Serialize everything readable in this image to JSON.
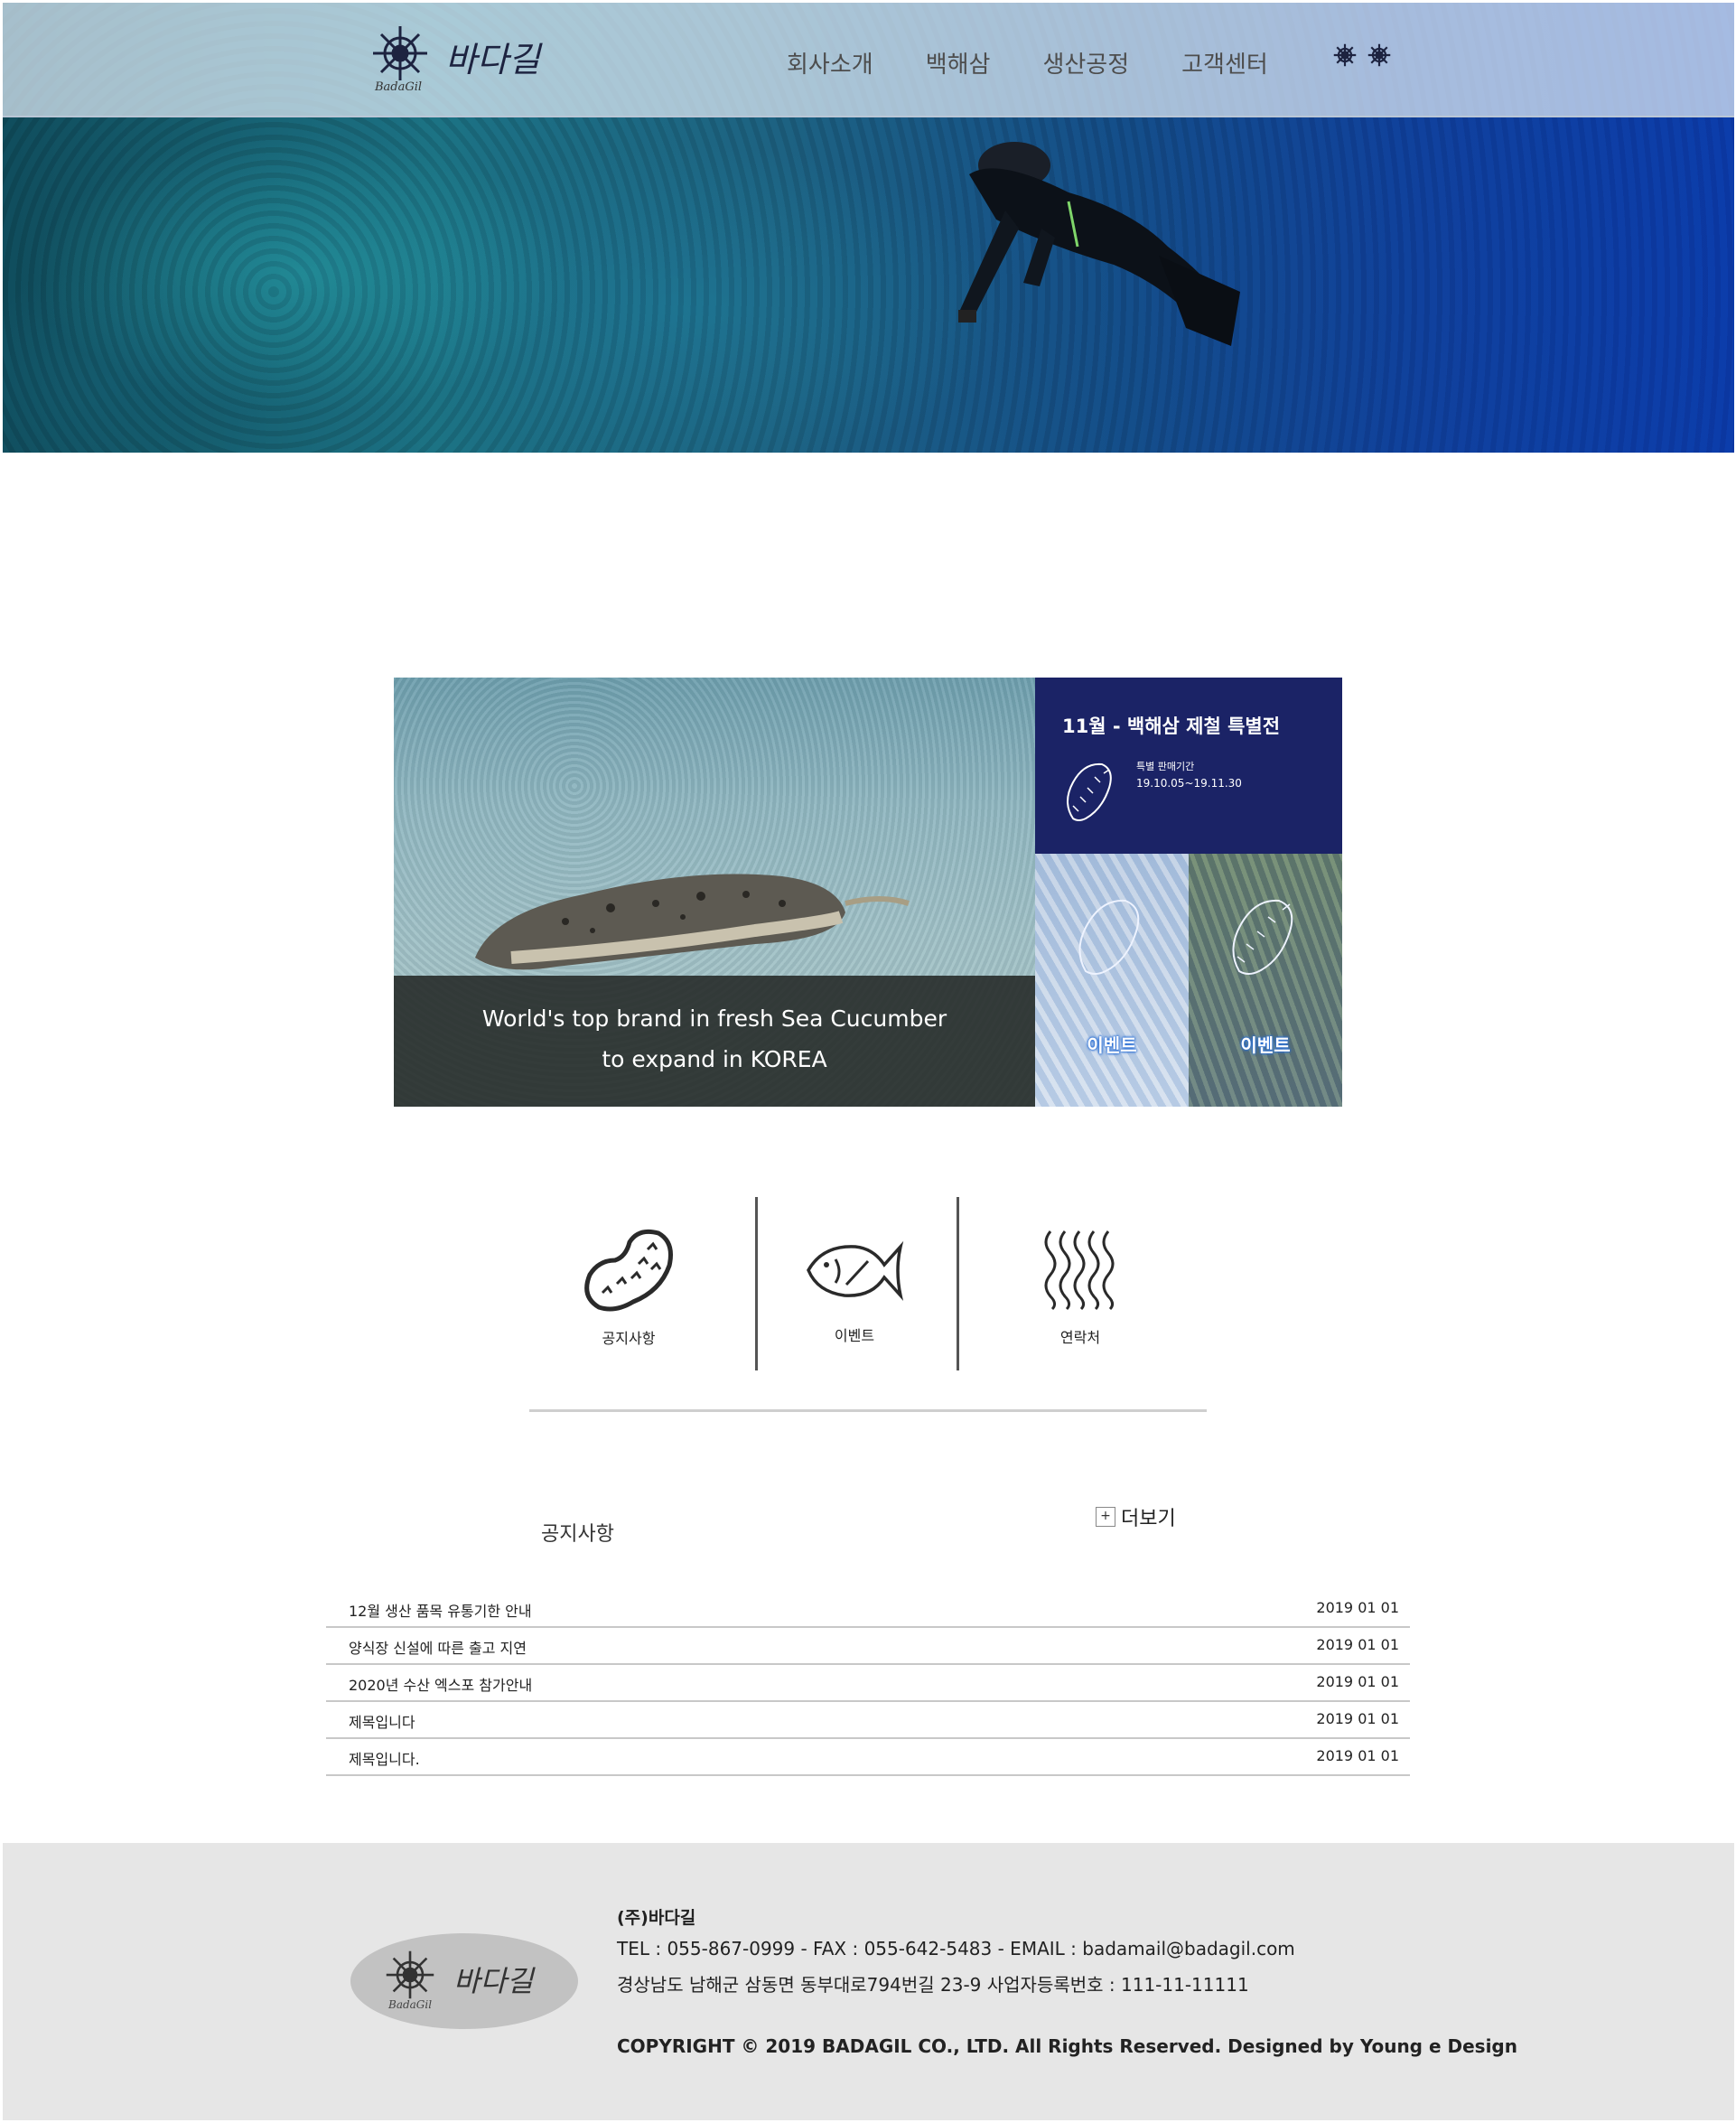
{
  "header": {
    "logo_text": "바다길",
    "logo_sub": "BadaGil",
    "nav": [
      "회사소개",
      "백해삼",
      "생산공정",
      "고객센터"
    ]
  },
  "promo": {
    "caption_line1": "World's top brand in fresh Sea Cucumber",
    "caption_line2": "to expand in KOREA",
    "special_title": "11월 - 백해삼 제철 특별전",
    "special_label": "특별 판매기간",
    "special_dates": "19.10.05~19.11.30",
    "event_label_1": "이벤트",
    "event_label_2": "이벤트"
  },
  "quick_links": [
    {
      "label": "공지사항",
      "icon": "sea-cucumber-icon"
    },
    {
      "label": "이벤트",
      "icon": "fish-icon"
    },
    {
      "label": "연락처",
      "icon": "waves-icon"
    }
  ],
  "notices": {
    "title": "공지사항",
    "more_label": "더보기",
    "more_symbol": "+",
    "items": [
      {
        "title": "12월 생산 품목 유통기한 안내",
        "date": "2019 01 01"
      },
      {
        "title": "양식장 신설에 따른 출고 지연",
        "date": "2019 01 01"
      },
      {
        "title": "2020년 수산 엑스포 참가안내",
        "date": "2019 01 01"
      },
      {
        "title": "제목입니다",
        "date": "2019 01 01"
      },
      {
        "title": "제목입니다.",
        "date": "2019 01 01"
      }
    ]
  },
  "footer": {
    "logo_text": "바다길",
    "logo_sub": "BadaGil",
    "company": "(주)바다길",
    "contact": "TEL : 055-867-0999 - FAX : 055-642-5483 - EMAIL : badamail@badagil.com",
    "address": "경상남도 남해군 삼동면 동부대로794번길 23-9 사업자등록번호 : 111-11-11111",
    "copyright": "COPYRIGHT © 2019 BADAGIL CO., LTD. All Rights Reserved. Designed by Young e Design"
  },
  "colors": {
    "special_bg": "#1b2366",
    "footer_bg": "#e6e6e6",
    "event_glow": "#2a6fd6"
  }
}
